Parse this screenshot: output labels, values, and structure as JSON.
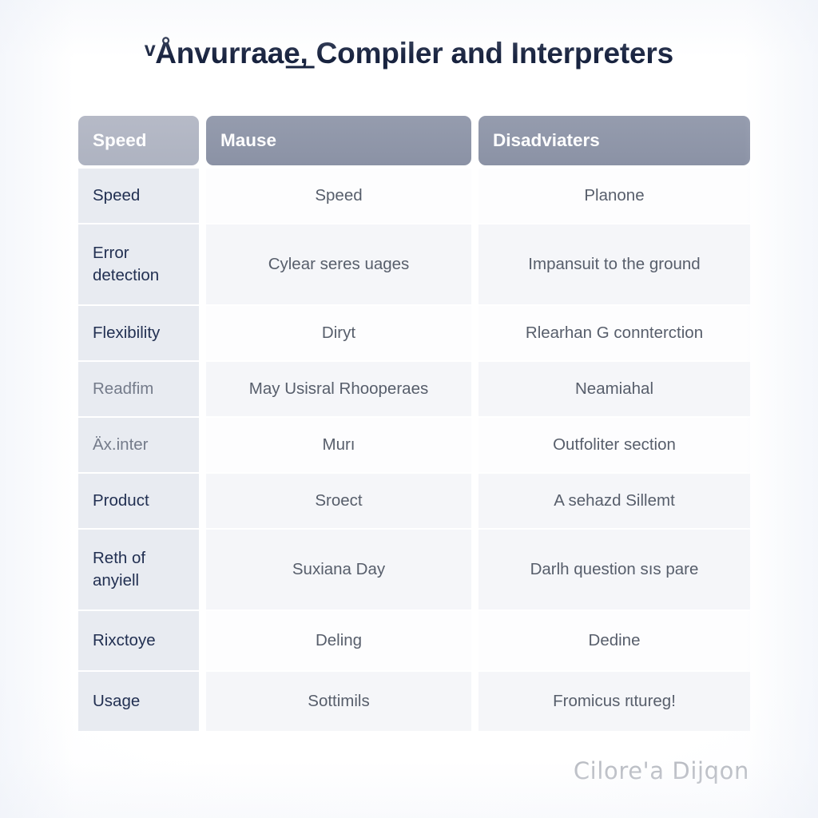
{
  "page": {
    "title": "ᵛÅnvurraae͟, Compiler and Interpreters",
    "watermark": "Cilore'a Dijqon",
    "background_color": "#ffffff",
    "title_color": "#18233f"
  },
  "colors": {
    "header_first_cell": "#b0b4c2",
    "header_cell": "#8e95a8",
    "header_text": "#ffffff",
    "first_column_cell": "#e8ebf1",
    "first_column_text": "#223052",
    "row_odd": "#fdfdfe",
    "row_even": "#f5f6f9",
    "body_text": "#575e6b",
    "faint_label_text": "#747b8a",
    "watermark_text": "#b9bcc3"
  },
  "table": {
    "headers": [
      "Speed",
      "Mause",
      "Disadviaters"
    ],
    "rows": [
      {
        "label": "Speed",
        "col2": "Speed",
        "col3": "Planone",
        "height": "h68",
        "stripe": "odd",
        "faint": false
      },
      {
        "label": "Error detection",
        "col2": "Cylear seres uages",
        "col3": "Impansuit to the ground",
        "height": "h100",
        "stripe": "even",
        "faint": false
      },
      {
        "label": "Flexibility",
        "col2": "Diryt",
        "col3": "Rlearhan G connterction",
        "height": "h68",
        "stripe": "odd",
        "faint": false
      },
      {
        "label": "Readfim",
        "col2": "May Usisral Rhooperaes",
        "col3": "Neamiahal",
        "height": "h68",
        "stripe": "even",
        "faint": true
      },
      {
        "label": "Äx.inter",
        "col2": "Murı",
        "col3": "Outfoliter section",
        "height": "h68",
        "stripe": "odd",
        "faint": true
      },
      {
        "label": "Product",
        "col2": "Sroect",
        "col3": "A sehazd  Sillemt",
        "height": "h68",
        "stripe": "even",
        "faint": false
      },
      {
        "label": "Reth of anyiell",
        "col2": "Suxiana Day",
        "col3": "Darlh question sıs pare",
        "height": "h100",
        "stripe": "even",
        "faint": false
      },
      {
        "label": "Rixctoye",
        "col2": "Deling",
        "col3": "Dedine",
        "height": "h74",
        "stripe": "odd",
        "faint": false
      },
      {
        "label": "Usage",
        "col2": "Sottimils",
        "col3": "Fromicus rɩtureg!",
        "height": "h74",
        "stripe": "even",
        "faint": false
      }
    ]
  }
}
